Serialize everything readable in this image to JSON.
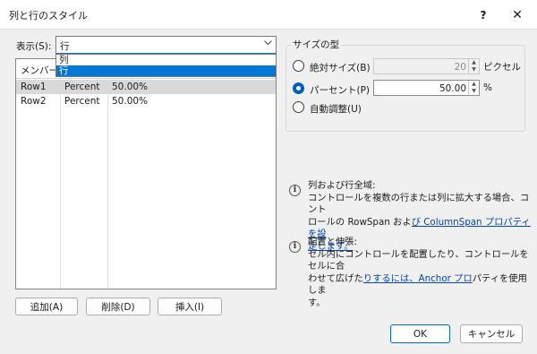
{
  "window": {
    "title": "列と行のスタイル",
    "help_glyph": "?",
    "close_glyph": "✕"
  },
  "show": {
    "label": "表示(S):",
    "value": "行",
    "options": [
      {
        "label": "列",
        "selected": false
      },
      {
        "label": "行",
        "selected": true
      }
    ]
  },
  "grid": {
    "header": "メンバー",
    "rows": [
      {
        "member": "Row1",
        "type": "Percent",
        "value": "50.00%",
        "selected": true
      },
      {
        "member": "Row2",
        "type": "Percent",
        "value": "50.00%",
        "selected": false
      }
    ]
  },
  "buttons": {
    "add": "追加(A)",
    "delete": "削除(D)",
    "insert": "挿入(I)",
    "ok": "OK",
    "cancel": "キャンセル"
  },
  "size_type": {
    "title": "サイズの型",
    "absolute": {
      "label": "絶対サイズ(B)",
      "value": "20",
      "unit": "ピクセル",
      "checked": false,
      "enabled": false
    },
    "percent": {
      "label": "パーセント(P)",
      "value": "50.00",
      "unit": "%",
      "checked": true
    },
    "auto": {
      "label": "自動調整(U)",
      "checked": false
    }
  },
  "info": {
    "first": {
      "line1": "列および行全域:",
      "line2": "コントロールを複数の行または列に拡大する場合、コント",
      "line3_a": "ロールの RowSpan およ",
      "line3_link": "び ColumnSpan プロパティを設",
      "line4_link": "定します。"
    },
    "second": {
      "line1": "配置と伸張:",
      "line2": "セル内にコントロールを配置したり、コントロールをセルに合",
      "line3_a": "わせて広げた",
      "line3_link": "りするには、Anchor プロ",
      "line3_b": "パティを使用しま",
      "line4": "す。"
    },
    "icon_glyph": "i"
  }
}
